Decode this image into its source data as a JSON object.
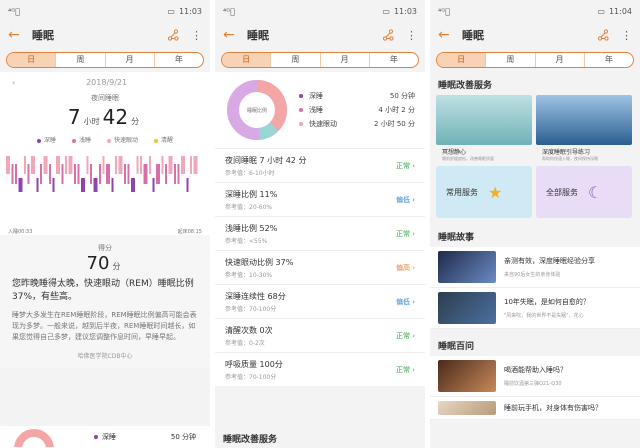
{
  "screens": [
    {
      "status": {
        "left": "⁴ᴳ᪲",
        "time": "11:03"
      },
      "title": "睡眠",
      "tabs": [
        "日",
        "周",
        "月",
        "年"
      ],
      "date": "2018/9/21",
      "night_label": "夜间睡眠",
      "hours": "7",
      "h_unit": "小时",
      "minutes": "42",
      "m_unit": "分",
      "legend": [
        "深睡",
        "浅睡",
        "快速眼动",
        "清醒"
      ],
      "sleep_start": "入睡00:33",
      "wake": "起床08:15",
      "score_label": "得分",
      "score": "70",
      "score_unit": "分",
      "summary": "您昨晚睡得太晚，快速眼动（REM）睡眠比例37%，有些高。",
      "detail": "睡梦大多发生在REM睡眠阶段，REM睡眠比例偏高可能会表现为多梦。一般来说，越到后半夜，REM睡眠时间越长，如果您觉得自己多梦，建议您调整作息时间，早睡早起。",
      "source": "哈佛医学院CDB中心",
      "bottom_legend": "深睡",
      "bottom_value": "50 分钟"
    },
    {
      "status": {
        "left": "⁴ᴳ᪲",
        "time": "11:03"
      },
      "title": "睡眠",
      "tabs": [
        "日",
        "周",
        "月",
        "年"
      ],
      "donut_label": "睡眠比例",
      "legend": [
        {
          "name": "深睡",
          "value": "50 分钟"
        },
        {
          "name": "浅睡",
          "value": "4 小时 2 分"
        },
        {
          "name": "快速眼动",
          "value": "2 小时 50 分"
        }
      ],
      "metrics": [
        {
          "name": "夜间睡眠 7 小时 42 分",
          "ref": "参考值：6-10小时",
          "status": "正常",
          "kind": "normal"
        },
        {
          "name": "深睡比例 11%",
          "ref": "参考值：20-60%",
          "status": "偏低",
          "kind": "low"
        },
        {
          "name": "浅睡比例 52%",
          "ref": "参考值：<55%",
          "status": "正常",
          "kind": "normal"
        },
        {
          "name": "快速眼动比例 37%",
          "ref": "参考值：10-30%",
          "status": "偏高",
          "kind": "high"
        },
        {
          "name": "深睡连续性 68分",
          "ref": "参考值：70-100分",
          "status": "偏低",
          "kind": "low"
        },
        {
          "name": "清醒次数 0次",
          "ref": "参考值：0-2次",
          "status": "正常",
          "kind": "normal"
        },
        {
          "name": "呼吸质量 100分",
          "ref": "参考值：70-100分",
          "status": "正常",
          "kind": "normal"
        }
      ],
      "bottom_section": "睡眠改善服务"
    },
    {
      "status": {
        "left": "⁴ᴳ᪲",
        "time": "11:04"
      },
      "title": "睡眠",
      "tabs": [
        "日",
        "周",
        "月",
        "年"
      ],
      "services_title": "睡眠改善服务",
      "services": [
        {
          "name": "冥想静心",
          "desc": "睡前舒缓放松，改善睡眠质量"
        },
        {
          "name": "深度睡眠引导练习",
          "desc": "帮助你快速入睡，夜间保持深睡"
        }
      ],
      "tiles": [
        "常用服务",
        "全部服务"
      ],
      "stories_title": "睡眠故事",
      "stories": [
        {
          "t": "亲测有效，深度睡眠经验分享",
          "s": "来自90后女生的亲身体验"
        },
        {
          "t": "10年失眠，是如何自愈的？",
          "s": "\"风来吹，我的世界不是失眠\"，花心"
        }
      ],
      "qa_title": "睡眠百问",
      "qa": [
        {
          "t": "喝酒能帮助入睡吗？",
          "s": "睡前饮酒第三弹Q21-Q30"
        },
        {
          "t": "睡前玩手机，对身体有伤害吗？",
          "s": ""
        }
      ]
    }
  ]
}
